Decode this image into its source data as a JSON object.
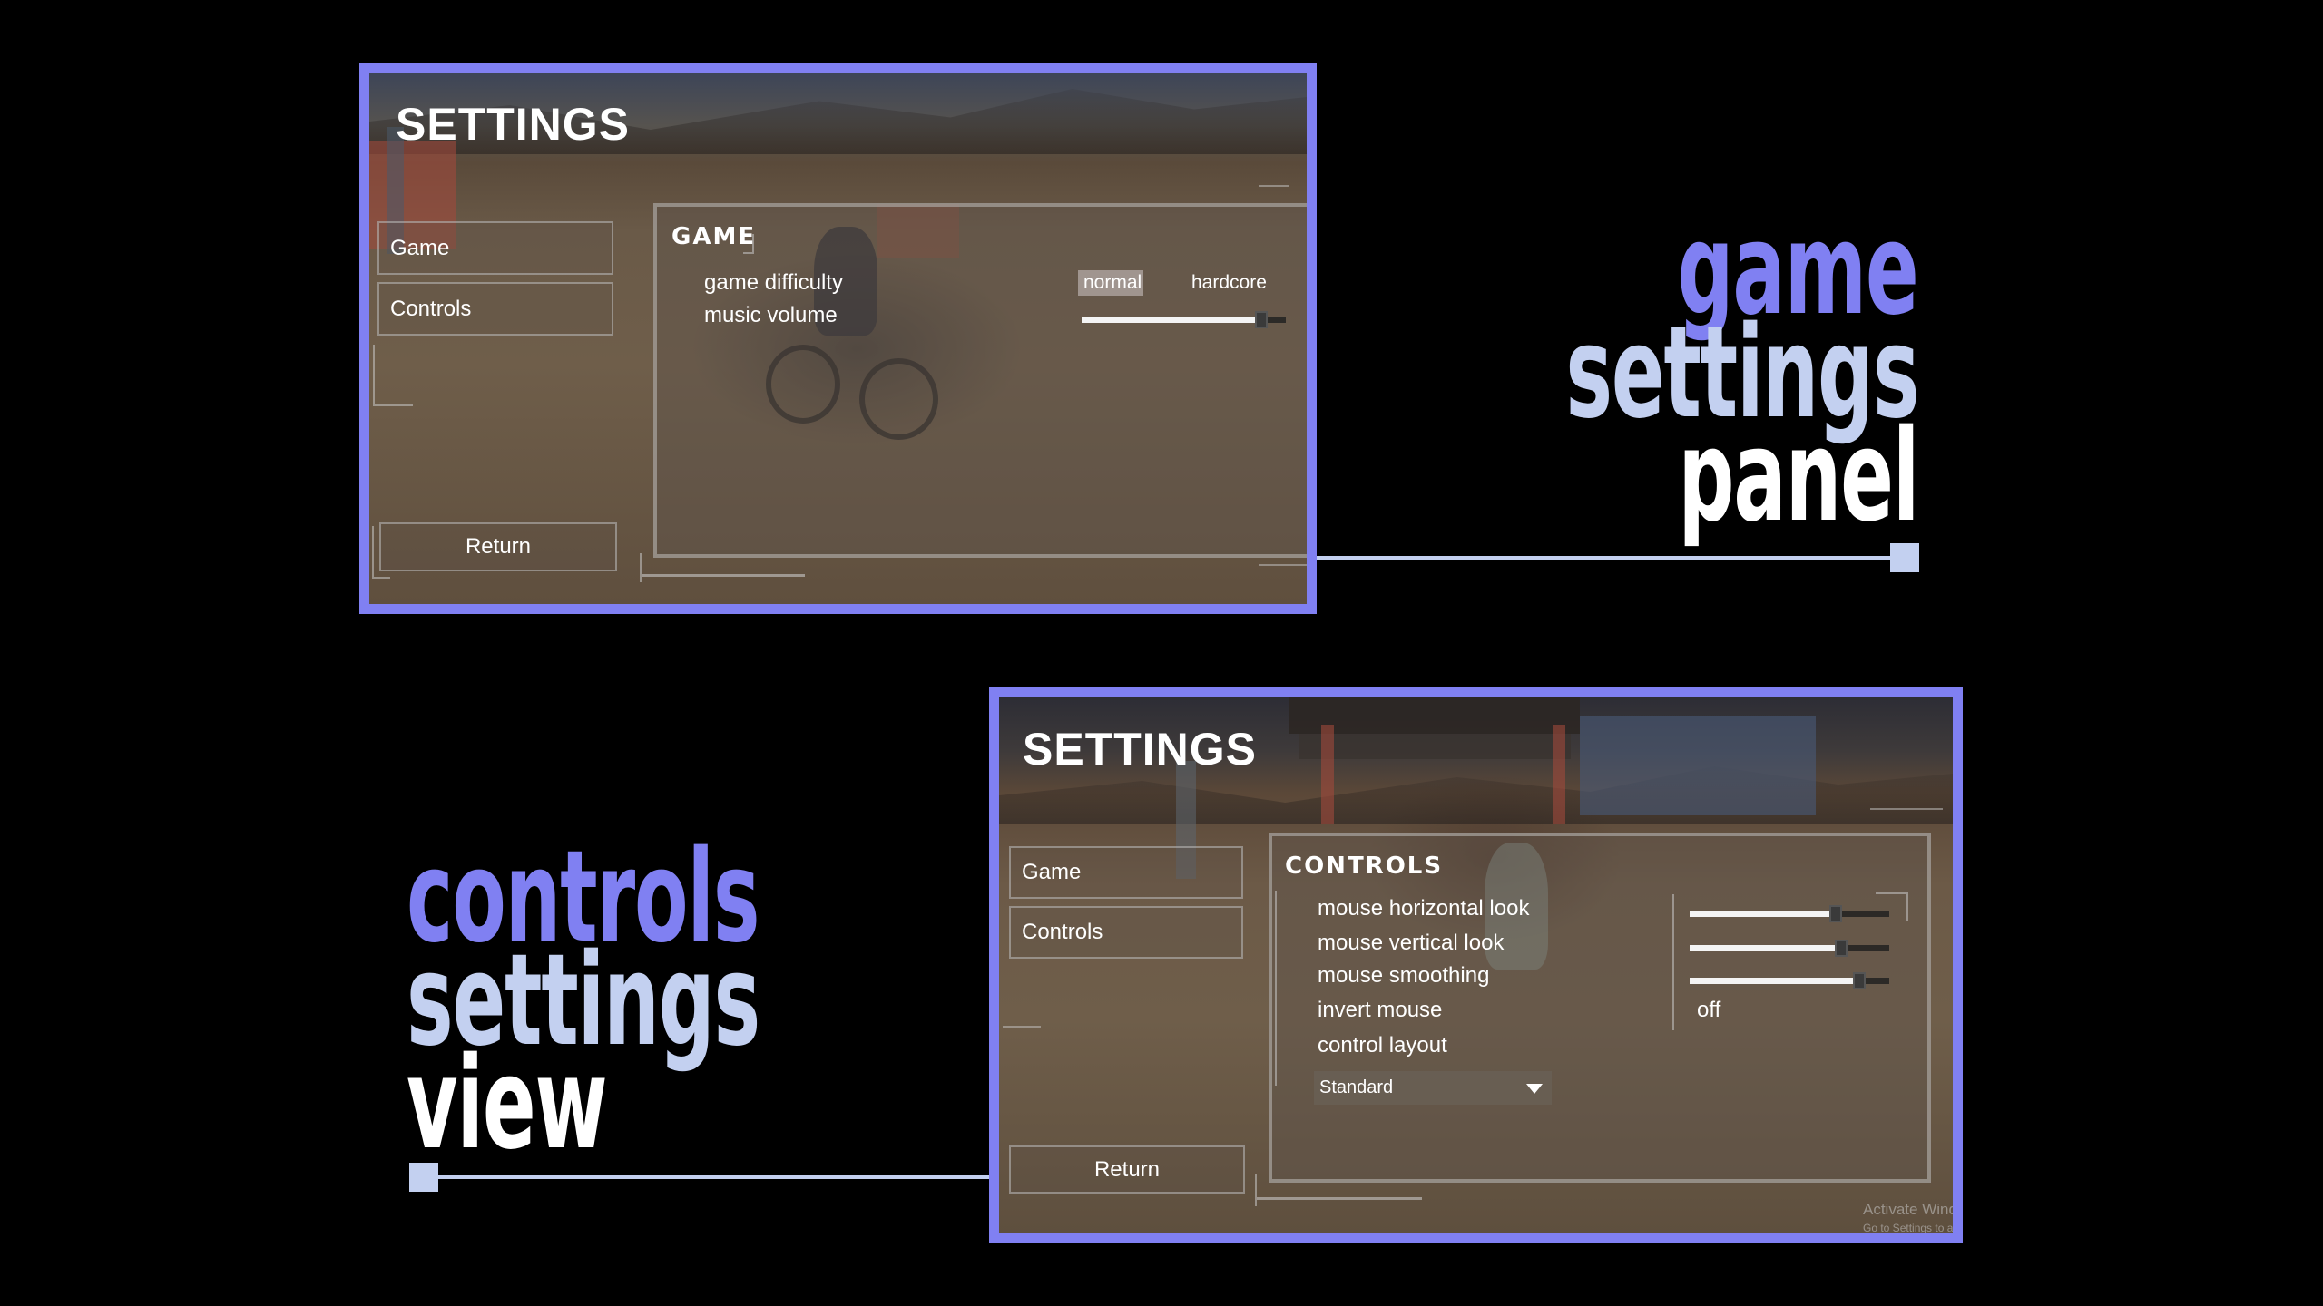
{
  "colors": {
    "frame": "#8080f2",
    "accent_violet": "#8080f2",
    "accent_periwinkle": "#c3d0f0",
    "text_white": "#ffffff",
    "background": "#000000"
  },
  "game_panel": {
    "title": "SETTINGS",
    "menu": [
      "Game",
      "Controls"
    ],
    "return_label": "Return",
    "section_header": "GAME",
    "rows": {
      "difficulty_label": "game difficulty",
      "difficulty_options": [
        "normal",
        "hardcore"
      ],
      "difficulty_selected": "normal",
      "music_label": "music volume",
      "music_volume_level": 0.88
    }
  },
  "controls_panel": {
    "title": "SETTINGS",
    "menu": [
      "Game",
      "Controls"
    ],
    "return_label": "Return",
    "section_header": "CONTROLS",
    "rows": {
      "horizontal_label": "mouse horizontal look",
      "horizontal_level": 0.73,
      "vertical_label": "mouse vertical look",
      "vertical_level": 0.76,
      "smoothing_label": "mouse smoothing",
      "smoothing_level": 0.85,
      "invert_label": "invert mouse",
      "invert_value": "off",
      "layout_label": "control layout",
      "layout_value": "Standard"
    },
    "watermark_line1": "Activate Wind",
    "watermark_line2": "Go to Settings to a"
  },
  "label_game": {
    "line1": "game",
    "line2": "settings",
    "line3": "panel"
  },
  "label_controls": {
    "line1": "controls",
    "line2": "settings",
    "line3": "view"
  }
}
